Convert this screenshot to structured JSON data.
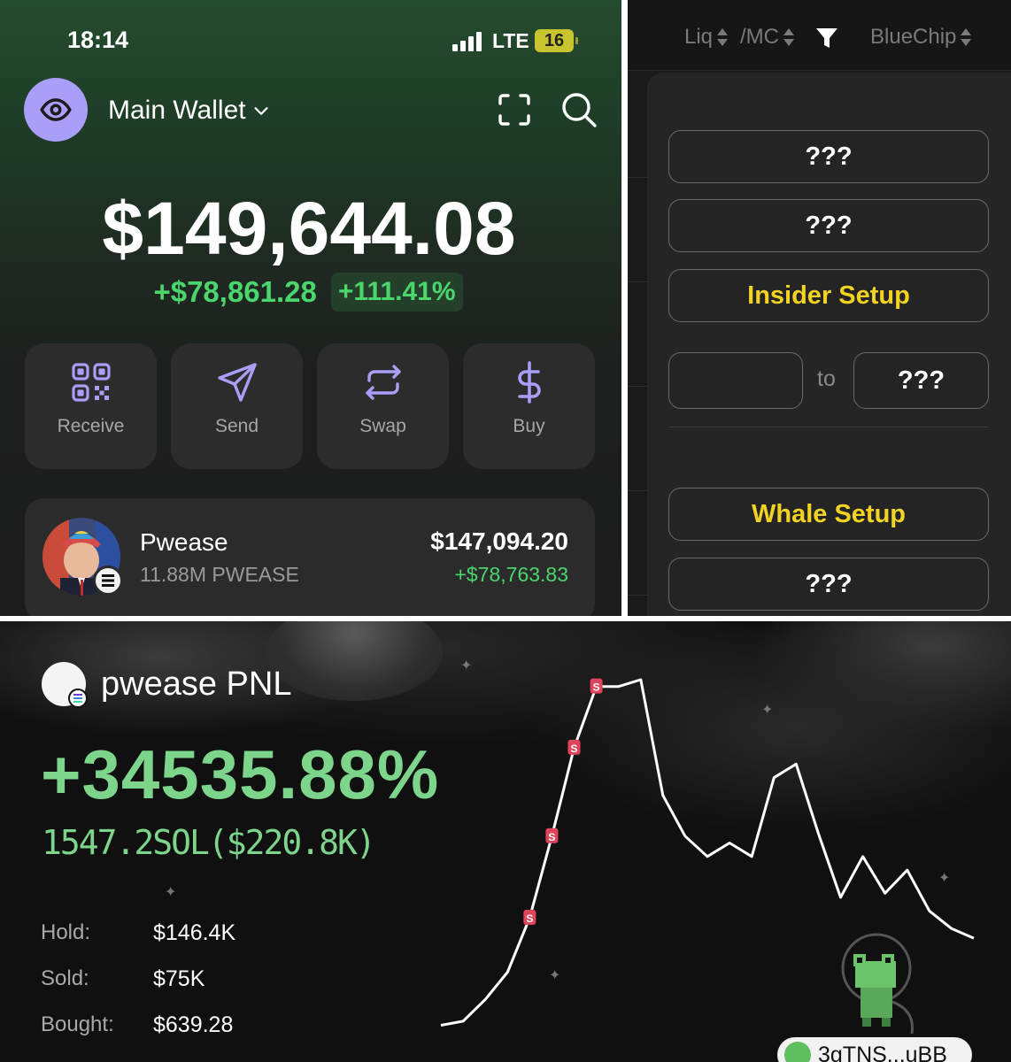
{
  "wallet": {
    "status_time": "18:14",
    "network": "LTE",
    "battery": "16",
    "wallet_name": "Main Wallet",
    "balance": "$149,644.08",
    "change_abs": "+$78,861.28",
    "change_pct": "+111.41%",
    "actions": [
      {
        "label": "Receive",
        "icon": "qr-code-icon"
      },
      {
        "label": "Send",
        "icon": "send-icon"
      },
      {
        "label": "Swap",
        "icon": "swap-icon"
      },
      {
        "label": "Buy",
        "icon": "dollar-icon"
      }
    ],
    "token": {
      "name": "Pwease",
      "amount": "11.88M PWEASE",
      "value": "$147,094.20",
      "gain": "+$78,763.83"
    },
    "colors": {
      "accent": "#a99ef8",
      "positive": "#4ad66d"
    }
  },
  "filter": {
    "columns": [
      "Liq",
      "/MC",
      "BlueChip"
    ],
    "buttons": [
      "???",
      "???",
      "Insider Setup",
      "Whale Setup",
      "???"
    ],
    "range": {
      "from": "",
      "to_label": "to",
      "to": "???"
    },
    "colors": {
      "highlight": "#f2d324"
    }
  },
  "pnl": {
    "title": "pwease PNL",
    "pct": "+34535.88%",
    "sol": "1547.2SOL($220.8K)",
    "stats": [
      {
        "label": "Hold:",
        "value": "$146.4K"
      },
      {
        "label": "Sold:",
        "value": "$75K"
      },
      {
        "label": "Bought:",
        "value": "$639.28"
      }
    ],
    "address": "3gTNS...uBB",
    "sell_marker": "S",
    "colors": {
      "positive": "#7dd58c",
      "marker": "#e0445a"
    }
  },
  "chart_data": {
    "type": "line",
    "title": "",
    "xlabel": "",
    "ylabel": "",
    "x": [
      0,
      1,
      2,
      3,
      4,
      5,
      6,
      7,
      8,
      9,
      10,
      11,
      12,
      13,
      14,
      15,
      16,
      17,
      18,
      19,
      20,
      21,
      22,
      23,
      24
    ],
    "values": [
      1,
      4,
      20,
      40,
      80,
      140,
      205,
      250,
      250,
      255,
      170,
      140,
      125,
      135,
      125,
      183,
      193,
      142,
      95,
      125,
      98,
      115,
      85,
      72,
      65
    ],
    "sell_marker_indices": [
      4,
      5,
      6,
      7
    ],
    "grid": false
  }
}
